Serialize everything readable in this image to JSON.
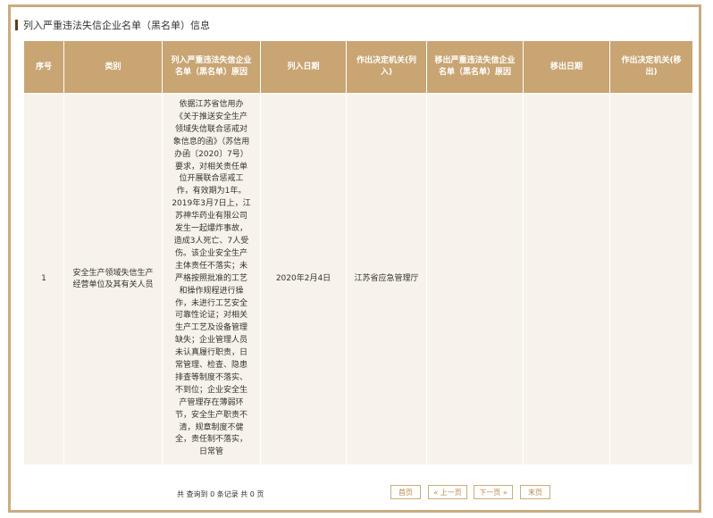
{
  "section_title": "列入严重违法失信企业名单（黑名单）信息",
  "table": {
    "headers": [
      "序号",
      "类别",
      "列入严重违法失信企业名单（黑名单）原因",
      "列入日期",
      "作出决定机关(列入)",
      "移出严重违法失信企业名单（黑名单）原因",
      "移出日期",
      "作出决定机关(移出)"
    ],
    "rows": [
      {
        "index": "1",
        "category": "安全生产领域失信生产经营单位及其有关人员",
        "reason": "依据江苏省信用办《关于推送安全生产领域失信联合惩戒对象信息的函》（苏信用办函〔2020〕7号）要求，对相关责任单位开展联合惩戒工作，有效期为1年。2019年3月7日上，江苏神华药业有限公司发生一起爆炸事故，造成3人死亡、7人受伤。该企业安全生产主体责任不落实；未严格按照批准的工艺和操作规程进行操作，未进行工艺安全可靠性论证；对相关生产工艺及设备管理缺失；企业管理人员未认真履行职责，日常管理、检查、隐患排查等制度不落实、不到位；企业安全生产管理存在薄弱环节，安全生产职责不清，规章制度不健全，责任制不落实，日常管",
        "date_in": "2020年2月4日",
        "authority_in": "江苏省应急管理厅",
        "reason_out": "",
        "date_out": "",
        "authority_out": ""
      }
    ]
  },
  "pager": {
    "info": "共 查询到 0 条记录 共 0 页",
    "first": "首页",
    "prev": "« 上一页",
    "next": "下一页 »",
    "last": "末页"
  },
  "colors": {
    "accent": "#c9a573",
    "border": "#c8ad7f",
    "cell_bg": "#f8f3ea"
  }
}
